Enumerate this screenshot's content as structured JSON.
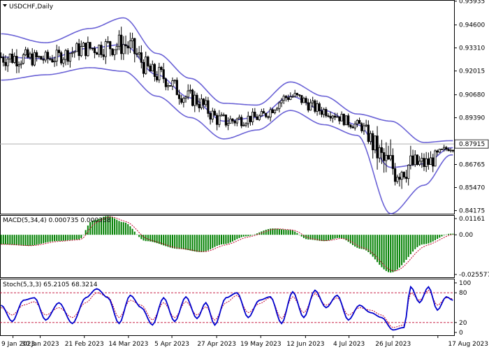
{
  "colors": {
    "background": "#ffffff",
    "axis": "#000000",
    "candle": "#000000",
    "bands": "#6b63d6",
    "macd_hist": "#008000",
    "macd_signal": "#c0002a",
    "stoch_main": "#0000cc",
    "stoch_signal": "#c0002a",
    "stoch_levels": "#c0002a",
    "price_line": "#b0b0b0"
  },
  "chart_data": [
    {
      "type": "candlestick",
      "title": "USDCHF,Daily",
      "y_ticks": [
        "0.95935",
        "0.94600",
        "0.93310",
        "0.92015",
        "0.90680",
        "0.89390",
        "0.86765",
        "0.85470",
        "0.84175"
      ],
      "ylim": [
        0.84,
        0.96
      ],
      "current_price": "0.87915",
      "current_price_value": 0.87915,
      "x_ticks": [
        "9 Jan 2023",
        "30 Jan 2023",
        "21 Feb 2023",
        "14 Mar 2023",
        "5 Apr 2023",
        "27 Apr 2023",
        "19 May 2023",
        "12 Jun 2023",
        "4 Jul 2023",
        "26 Jul 2023",
        "17 Aug 2023"
      ],
      "bollinger_anchor_x": [
        0,
        20,
        40,
        55,
        70,
        85,
        100,
        115,
        130,
        145,
        160,
        175,
        190,
        202
      ],
      "bollinger_mid": [
        0.928,
        0.927,
        0.933,
        0.935,
        0.918,
        0.905,
        0.892,
        0.894,
        0.906,
        0.898,
        0.89,
        0.866,
        0.868,
        0.877
      ],
      "bollinger_width": [
        0.013,
        0.009,
        0.011,
        0.015,
        0.012,
        0.011,
        0.01,
        0.007,
        0.008,
        0.008,
        0.006,
        0.026,
        0.012,
        0.004
      ]
    },
    {
      "type": "bar",
      "title": "MACD(5,34,4) 0.000735 0.000338",
      "y_ticks": [
        "0.01161",
        "0.00",
        "-0.025577"
      ],
      "ylim": [
        -0.027,
        0.0125
      ],
      "anchor_x": [
        0,
        12,
        25,
        35,
        41,
        48,
        55,
        65,
        80,
        90,
        100,
        110,
        122,
        130,
        138,
        145,
        152,
        162,
        175,
        190,
        202
      ],
      "values": [
        -0.006,
        -0.007,
        -0.004,
        -0.003,
        0.009,
        0.012,
        0.008,
        -0.004,
        -0.009,
        -0.011,
        -0.006,
        -0.001,
        0.004,
        0.003,
        -0.003,
        -0.004,
        -0.002,
        -0.009,
        -0.024,
        -0.006,
        0.0007
      ]
    },
    {
      "type": "line",
      "title": "Stoch(5,3,3) 65.2105 68.3214",
      "y_ticks": [
        "100",
        "80",
        "20",
        "0"
      ],
      "levels": [
        80,
        20
      ],
      "ylim": [
        0,
        100
      ],
      "anchor_x": [
        0,
        5,
        10,
        15,
        20,
        26,
        32,
        38,
        43,
        48,
        53,
        58,
        63,
        68,
        73,
        78,
        83,
        88,
        92,
        96,
        101,
        106,
        111,
        116,
        121,
        126,
        131,
        136,
        141,
        146,
        151,
        156,
        161,
        166,
        171,
        176,
        181,
        184,
        188,
        192,
        196,
        200,
        203
      ],
      "main": [
        55,
        22,
        65,
        70,
        25,
        60,
        18,
        70,
        88,
        70,
        18,
        75,
        50,
        15,
        70,
        22,
        72,
        28,
        60,
        15,
        70,
        80,
        30,
        65,
        72,
        18,
        82,
        30,
        85,
        50,
        75,
        25,
        55,
        40,
        30,
        5,
        10,
        92,
        60,
        92,
        45,
        72,
        65
      ],
      "signal": [
        50,
        35,
        55,
        62,
        35,
        50,
        30,
        60,
        80,
        72,
        30,
        65,
        55,
        25,
        60,
        30,
        62,
        35,
        52,
        25,
        60,
        75,
        40,
        58,
        70,
        28,
        72,
        40,
        78,
        55,
        70,
        35,
        50,
        45,
        35,
        10,
        15,
        80,
        65,
        85,
        55,
        70,
        68
      ]
    }
  ]
}
